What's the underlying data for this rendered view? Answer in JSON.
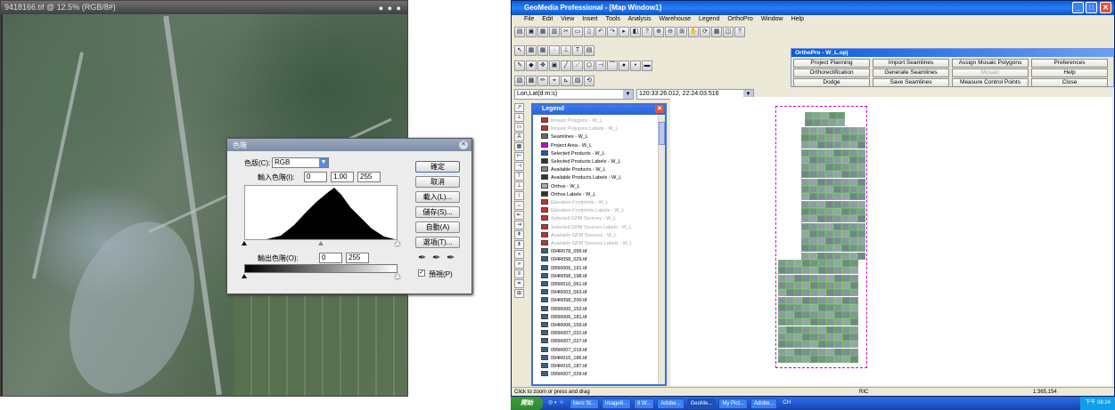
{
  "photoshop": {
    "title": "9418166.tif @ 12.5% (RGB/8#)",
    "levels": {
      "title": "色階",
      "channel_label": "色版(C):",
      "channel_value": "RGB",
      "input_label": "輸入色階(I):",
      "input_black": "0",
      "input_gamma": "1.00",
      "input_white": "255",
      "output_label": "輸出色階(O):",
      "output_black": "0",
      "output_white": "255",
      "buttons": [
        "確定",
        "取消",
        "載入(L)...",
        "儲存(S)...",
        "自動(A)",
        "選項(T)..."
      ],
      "preview_label": "預視(P)"
    }
  },
  "geomedia": {
    "title": "GeoMedia Professional - [Map Window1]",
    "menu": [
      "File",
      "Edit",
      "View",
      "Insert",
      "Tools",
      "Analysis",
      "Warehouse",
      "Legend",
      "OrthoPro",
      "Window",
      "Help"
    ],
    "coord_system": "Lon,Lat(d:m:s)",
    "coord_value": "120:33:26.012, 22:24:03.516",
    "orthopro": {
      "title": "OrthoPro - W_L.opj",
      "buttons": [
        [
          {
            "label": "Project Planning",
            "enabled": true
          },
          {
            "label": "Import Seamlines",
            "enabled": true
          },
          {
            "label": "Assign Mosaic Polygons",
            "enabled": true
          },
          {
            "label": "Preferences",
            "enabled": true
          }
        ],
        [
          {
            "label": "Orthorectification",
            "enabled": true
          },
          {
            "label": "Generate Seamlines",
            "enabled": true
          },
          {
            "label": "Mosaic",
            "enabled": false
          },
          {
            "label": "Help",
            "enabled": true
          }
        ],
        [
          {
            "label": "Dodge",
            "enabled": true
          },
          {
            "label": "Save Seamlines",
            "enabled": true
          },
          {
            "label": "Measure Control Points",
            "enabled": true
          },
          {
            "label": "Close",
            "enabled": true
          }
        ]
      ]
    },
    "legend": {
      "title": "Legend",
      "items": [
        {
          "label": "Mosaic Polygons - W_L",
          "active": false,
          "color": "#c8302a"
        },
        {
          "label": "Mosaic Polygons Labels - W_L",
          "active": false,
          "color": "#c8302a"
        },
        {
          "label": "Seamlines - W_L",
          "active": true,
          "color": "#6a6a6a"
        },
        {
          "label": "Project Area - W_L",
          "active": true,
          "color": "#d000d0"
        },
        {
          "label": "Selected Products - W_L",
          "active": true,
          "color": "#3050c0"
        },
        {
          "label": "Selected Products Labels - W_L",
          "active": true,
          "color": "#333333"
        },
        {
          "label": "Available Products - W_L",
          "active": true,
          "color": "#888888"
        },
        {
          "label": "Available Products Labels - W_L",
          "active": true,
          "color": "#333333"
        },
        {
          "label": "Orthos - W_L",
          "active": true,
          "color": "#aaaaaa"
        },
        {
          "label": "Orthos Labels - W_L",
          "active": true,
          "color": "#333333"
        },
        {
          "label": "Elevation Footprints - W_L",
          "active": false,
          "color": "#c8302a"
        },
        {
          "label": "Elevation Footprints Labels - W_L",
          "active": false,
          "color": "#c8302a"
        },
        {
          "label": "Selected GPM Sources - W_L",
          "active": false,
          "color": "#c8302a"
        },
        {
          "label": "Selected GPM Sources Labels - W_L",
          "active": false,
          "color": "#c8302a"
        },
        {
          "label": "Available GPM Sources - W_L",
          "active": false,
          "color": "#c8302a"
        },
        {
          "label": "Available GPM Sources Labels - W_L",
          "active": false,
          "color": "#c8302a"
        },
        {
          "label": "094R078_099.tif",
          "active": true,
          "color": "#3a5e8c"
        },
        {
          "label": "094R058_029.tif",
          "active": true,
          "color": "#3a5e8c"
        },
        {
          "label": "095R006_191.tif",
          "active": true,
          "color": "#3a5e8c"
        },
        {
          "label": "094R058_198.tif",
          "active": true,
          "color": "#3a5e8c"
        },
        {
          "label": "095R010_061.tif",
          "active": true,
          "color": "#3a5e8c"
        },
        {
          "label": "094R003_063.tif",
          "active": true,
          "color": "#3a5e8c"
        },
        {
          "label": "094R058_200.tif",
          "active": true,
          "color": "#3a5e8c"
        },
        {
          "label": "095R000_153.tif",
          "active": true,
          "color": "#3a5e8c"
        },
        {
          "label": "095R006_181.tif",
          "active": true,
          "color": "#3a5e8c"
        },
        {
          "label": "094R006_159.tif",
          "active": true,
          "color": "#3a5e8c"
        },
        {
          "label": "095R007_031.tif",
          "active": true,
          "color": "#3a5e8c"
        },
        {
          "label": "095R007_027.tif",
          "active": true,
          "color": "#3a5e8c"
        },
        {
          "label": "095R007_019.tif",
          "active": true,
          "color": "#3a5e8c"
        },
        {
          "label": "094R010_186.tif",
          "active": true,
          "color": "#3a5e8c"
        },
        {
          "label": "094R010_187.tif",
          "active": true,
          "color": "#3a5e8c"
        },
        {
          "label": "095R007_029.tif",
          "active": true,
          "color": "#3a5e8c"
        }
      ]
    },
    "status": {
      "hint": "Click to zoom or press and drag",
      "mode": "RIC",
      "scale": "1:365,154"
    }
  },
  "taskbar": {
    "start": "開始",
    "tasks": [
      "Nero St...",
      "Image8...",
      "8 W...",
      "Adobe...",
      "GeoMe...",
      "My Pict...",
      "Adobe...",
      "CH"
    ],
    "clock": "下午 08:24"
  },
  "colors": {
    "xp_blue": "#245edb",
    "project_area": "#d000d0",
    "seamline": "#56a856"
  }
}
